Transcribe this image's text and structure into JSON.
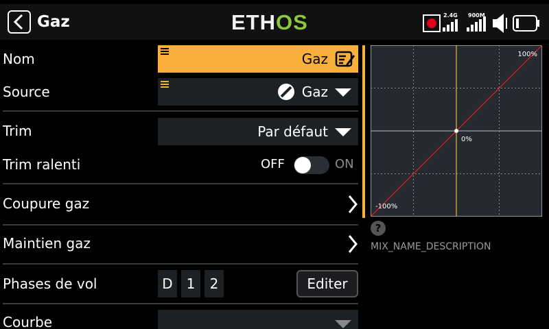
{
  "header": {
    "title": "Gaz",
    "logo_part1": "ETH",
    "logo_part2": "OS",
    "status": {
      "signal_24": "2.4G",
      "signal_900": "900M"
    }
  },
  "form": {
    "name_label": "Nom",
    "name_value": "Gaz",
    "source_label": "Source",
    "source_value": "Gaz",
    "trim_label": "Trim",
    "trim_value": "Par défaut",
    "idle_trim_label": "Trim ralenti",
    "idle_trim_off": "OFF",
    "idle_trim_on": "ON",
    "throttle_cut_label": "Coupure gaz",
    "throttle_hold_label": "Maintien gaz",
    "flight_modes_label": "Phases de vol",
    "flight_modes": [
      "D",
      "1",
      "2"
    ],
    "edit_label": "Editer",
    "curve_label": "Courbe"
  },
  "graph": {
    "top_label": "100%",
    "center_label": "0%",
    "bottom_label": "-100%",
    "help_glyph": "?",
    "description": "MIX_NAME_DESCRIPTION"
  },
  "chart_data": {
    "type": "line",
    "x": [
      -100,
      0,
      100
    ],
    "y": [
      -100,
      0,
      100
    ],
    "xlim": [
      -100,
      100
    ],
    "ylim": [
      -100,
      100
    ],
    "grid": true,
    "line_color": "#e02020",
    "cursor_color": "#f8b03b",
    "annotations": [
      "100%",
      "0%",
      "-100%"
    ]
  },
  "colors": {
    "accent": "#f8b03b",
    "logo_green": "#8dc63f",
    "record": "#e0001a"
  },
  "icons": {
    "back": "chevron-left-icon",
    "edit": "edit-icon",
    "source": "slash-circle-icon",
    "dropdown": "triangle-down-icon",
    "submenu": "chevron-right-icon"
  }
}
